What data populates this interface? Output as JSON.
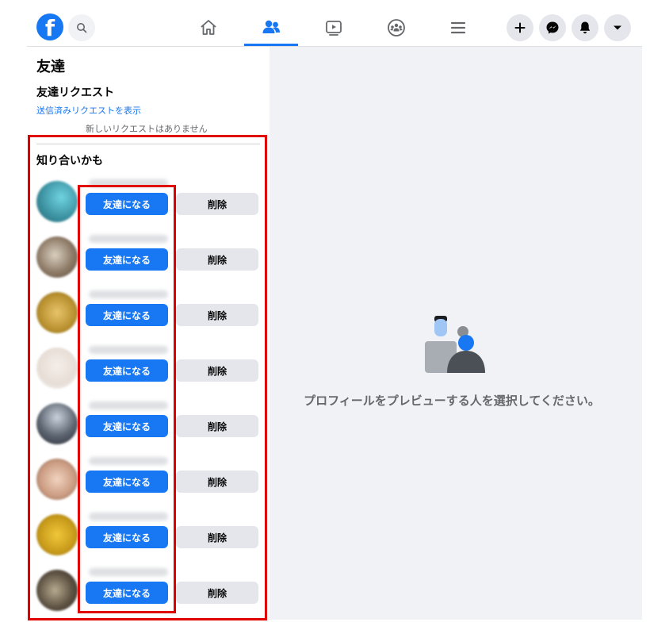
{
  "topbar": {
    "logo_text": "f",
    "search_icon": "search-icon",
    "nav": [
      {
        "name": "home-icon",
        "active": false
      },
      {
        "name": "friends-icon",
        "active": true
      },
      {
        "name": "watch-icon",
        "active": false
      },
      {
        "name": "groups-icon",
        "active": false
      },
      {
        "name": "menu-icon",
        "active": false
      }
    ],
    "right_icons": [
      "plus-icon",
      "messenger-icon",
      "notification-bell-icon",
      "caret-down-icon"
    ]
  },
  "sidebar": {
    "title": "友達",
    "requests_title": "友達リクエスト",
    "sent_requests_link": "送信済みリクエストを表示",
    "no_requests_text": "新しいリクエストはありません",
    "pymk_title": "知り合いかも",
    "confirm_label": "友達になる",
    "delete_label": "削除",
    "suggestions": [
      {
        "confirm": "友達になる",
        "delete": "削除"
      },
      {
        "confirm": "友達になる",
        "delete": "削除"
      },
      {
        "confirm": "友達になる",
        "delete": "削除"
      },
      {
        "confirm": "友達になる",
        "delete": "削除"
      },
      {
        "confirm": "友達になる",
        "delete": "削除"
      },
      {
        "confirm": "友達になる",
        "delete": "削除"
      },
      {
        "confirm": "友達になる",
        "delete": "削除"
      },
      {
        "confirm": "友達になる",
        "delete": "削除"
      }
    ]
  },
  "main": {
    "empty_state_text": "プロフィールをプレビューする人を選択してください。",
    "illustration_icon": "people-preview-icon"
  },
  "colors": {
    "accent": "#1877f2",
    "highlight": "#e00000",
    "panel_bg": "#f0f2f5",
    "button_secondary": "#e4e6eb"
  }
}
